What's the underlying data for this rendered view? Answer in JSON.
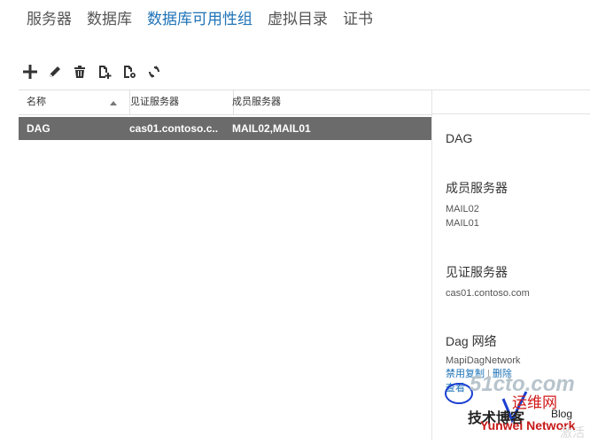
{
  "tabs": [
    {
      "label": "服务器"
    },
    {
      "label": "数据库"
    },
    {
      "label": "数据库可用性组"
    },
    {
      "label": "虚拟目录"
    },
    {
      "label": "证书"
    }
  ],
  "toolbar": {
    "icons": [
      "plus-icon",
      "edit-icon",
      "delete-icon",
      "add-server-icon",
      "network-settings-icon",
      "refresh-icon"
    ]
  },
  "grid": {
    "columns": [
      "名称",
      "见证服务器",
      "成员服务器"
    ],
    "rows": [
      {
        "name": "DAG",
        "witness": "cas01.contoso.c...",
        "members": "MAIL02,MAIL01"
      }
    ]
  },
  "details": {
    "name": "DAG",
    "members_heading": "成员服务器",
    "members": [
      "MAIL02",
      "MAIL01"
    ],
    "witness_heading": "见证服务器",
    "witness": "cas01.contoso.com",
    "network_heading": "Dag 网络",
    "network_name": "MapiDagNetwork",
    "disable_replication": "禁用复制",
    "delete": "删除",
    "view": "查看"
  },
  "watermark": {
    "site": "51cto.com",
    "line1": "运维网",
    "line2": "技术博客",
    "blog": "Blog",
    "brand": "Yunwei Network",
    "activate": "激活"
  },
  "colors": {
    "accent": "#1f73b7",
    "selected_row": "#6b6b6b"
  }
}
